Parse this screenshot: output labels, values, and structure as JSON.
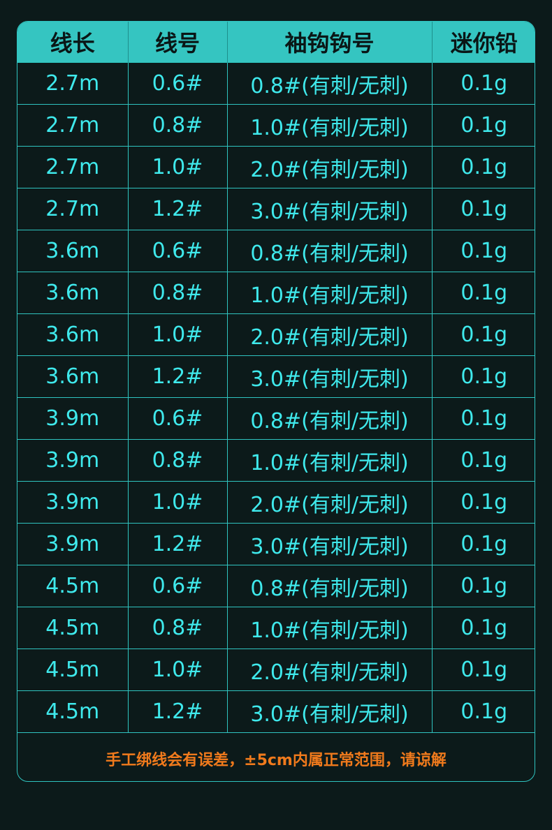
{
  "headers": [
    "线长",
    "线号",
    "袖钩钩号",
    "迷你铅"
  ],
  "rows": [
    [
      "2.7m",
      "0.6#",
      "0.8#(有刺/无刺)",
      "0.1g"
    ],
    [
      "2.7m",
      "0.8#",
      "1.0#(有刺/无刺)",
      "0.1g"
    ],
    [
      "2.7m",
      "1.0#",
      "2.0#(有刺/无刺)",
      "0.1g"
    ],
    [
      "2.7m",
      "1.2#",
      "3.0#(有刺/无刺)",
      "0.1g"
    ],
    [
      "3.6m",
      "0.6#",
      "0.8#(有刺/无刺)",
      "0.1g"
    ],
    [
      "3.6m",
      "0.8#",
      "1.0#(有刺/无刺)",
      "0.1g"
    ],
    [
      "3.6m",
      "1.0#",
      "2.0#(有刺/无刺)",
      "0.1g"
    ],
    [
      "3.6m",
      "1.2#",
      "3.0#(有刺/无刺)",
      "0.1g"
    ],
    [
      "3.9m",
      "0.6#",
      "0.8#(有刺/无刺)",
      "0.1g"
    ],
    [
      "3.9m",
      "0.8#",
      "1.0#(有刺/无刺)",
      "0.1g"
    ],
    [
      "3.9m",
      "1.0#",
      "2.0#(有刺/无刺)",
      "0.1g"
    ],
    [
      "3.9m",
      "1.2#",
      "3.0#(有刺/无刺)",
      "0.1g"
    ],
    [
      "4.5m",
      "0.6#",
      "0.8#(有刺/无刺)",
      "0.1g"
    ],
    [
      "4.5m",
      "0.8#",
      "1.0#(有刺/无刺)",
      "0.1g"
    ],
    [
      "4.5m",
      "1.0#",
      "2.0#(有刺/无刺)",
      "0.1g"
    ],
    [
      "4.5m",
      "1.2#",
      "3.0#(有刺/无刺)",
      "0.1g"
    ]
  ],
  "note": "手工绑线会有误差，±5cm内属正常范围，请谅解",
  "colors": {
    "header_bg": "#35c5c1",
    "cell_text": "#3fe9ec",
    "note_text": "#f07a1c",
    "background": "#0c1a1a"
  }
}
